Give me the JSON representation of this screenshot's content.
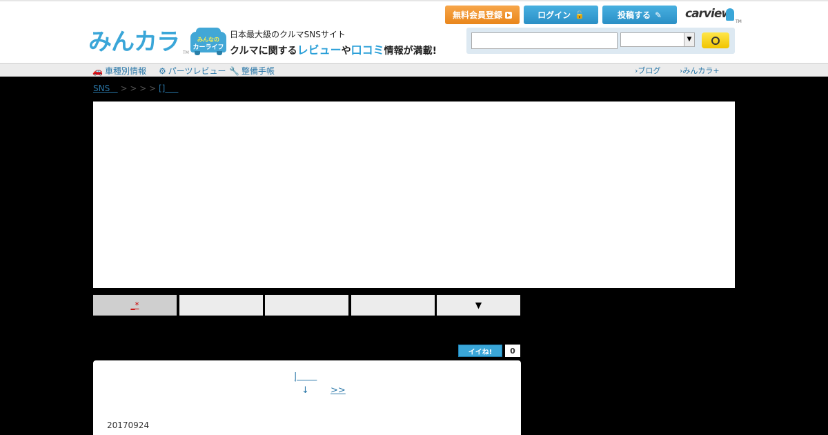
{
  "header": {
    "logo_text": "みんカラ",
    "logo_tm": "TM",
    "carlife_line1": "みんなの",
    "carlife_line2": "カーライフ",
    "tagline1": "日本最大級のクルマSNSサイト",
    "tagline2_pre": "クルマに関する",
    "tagline2_hl1": "レビュー",
    "tagline2_mid": "や",
    "tagline2_hl2": "口コミ",
    "tagline2_post": "情報が満載!",
    "register_label": "無料会員登録",
    "login_label": "ログイン",
    "post_label": "投稿する",
    "carview_label": "carview",
    "carview_tm": "TM"
  },
  "search": {
    "input_value": "",
    "select_value": ""
  },
  "nav": {
    "left": [
      {
        "label": "車種別情報",
        "icon": "🚗"
      },
      {
        "label": "パーツレビュー",
        "icon": "⚙"
      },
      {
        "label": "整備手帳",
        "icon": "🔧"
      }
    ],
    "right": [
      {
        "label": "ブログ"
      },
      {
        "label": "みんカラ+"
      }
    ]
  },
  "breadcrumb": {
    "first": "SNS",
    "middle": " > > > > ",
    "last": "[]"
  },
  "tabs": [
    {
      "label": "_*",
      "active": true
    },
    {
      "label": "",
      "active": false
    },
    {
      "label": "",
      "active": false
    },
    {
      "label": "",
      "active": false
    },
    {
      "label": "▼",
      "active": false
    }
  ],
  "like": {
    "label": "イイね!",
    "count": "0"
  },
  "content": {
    "link_top": "|",
    "link_down": "↓",
    "link_next": ">>",
    "date": "20170924"
  }
}
